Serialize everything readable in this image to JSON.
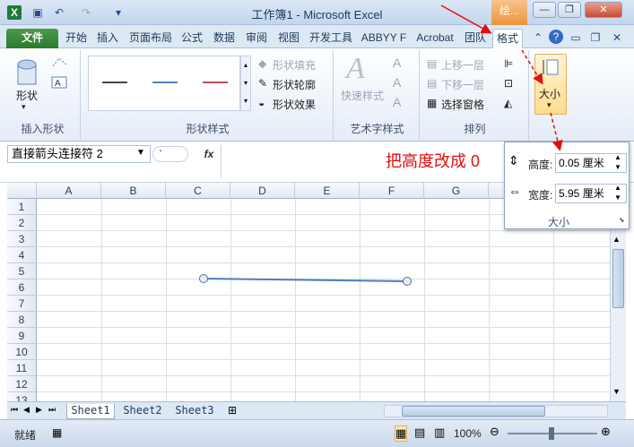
{
  "window": {
    "title": "工作簿1 - Microsoft Excel",
    "context_tab": "绘...",
    "minimize": "—",
    "restore": "❐",
    "close": "✕"
  },
  "tabs": [
    "文件",
    "开始",
    "插入",
    "页面布局",
    "公式",
    "数据",
    "审阅",
    "视图",
    "开发工具",
    "ABBYY F",
    "Acrobat",
    "团队",
    "格式"
  ],
  "active_tab": "格式",
  "ribbon": {
    "insert_shapes": {
      "shapes_label": "形状",
      "group_label": "插入形状"
    },
    "shape_styles": {
      "fill": "形状填充",
      "outline": "形状轮廓",
      "effects": "形状效果",
      "group_label": "形状样式",
      "swatch_colors": [
        "#444444",
        "#4f81bd",
        "#c0504d"
      ]
    },
    "art_text": {
      "quick_styles": "快速样式",
      "group_label": "艺术字样式"
    },
    "arrange": {
      "bring_forward": "上移一层",
      "send_backward": "下移一层",
      "selection_pane": "选择窗格",
      "group_label": "排列"
    },
    "size": {
      "label": "大小"
    }
  },
  "formula_bar": {
    "name_box": "直接箭头连接符 2",
    "fx": "fx",
    "annotation": "把高度改成 0"
  },
  "size_popup": {
    "height_label": "高度:",
    "height_value": "0.05 厘米",
    "width_label": "宽度:",
    "width_value": "5.95 厘米",
    "group_label": "大小"
  },
  "grid": {
    "columns": [
      "A",
      "B",
      "C",
      "D",
      "E",
      "F",
      "G"
    ],
    "rows": [
      "1",
      "2",
      "3",
      "4",
      "5",
      "6",
      "7",
      "8",
      "9",
      "10",
      "11",
      "12",
      "13"
    ]
  },
  "sheet_tabs": [
    "Sheet1",
    "Sheet2",
    "Sheet3"
  ],
  "status": {
    "ready": "就绪",
    "zoom": "100%"
  },
  "colors": {
    "annotation": "#e01010",
    "arrow": "#e01010",
    "line": "#4a7ebb",
    "file_tab": "#2c7a2c"
  }
}
